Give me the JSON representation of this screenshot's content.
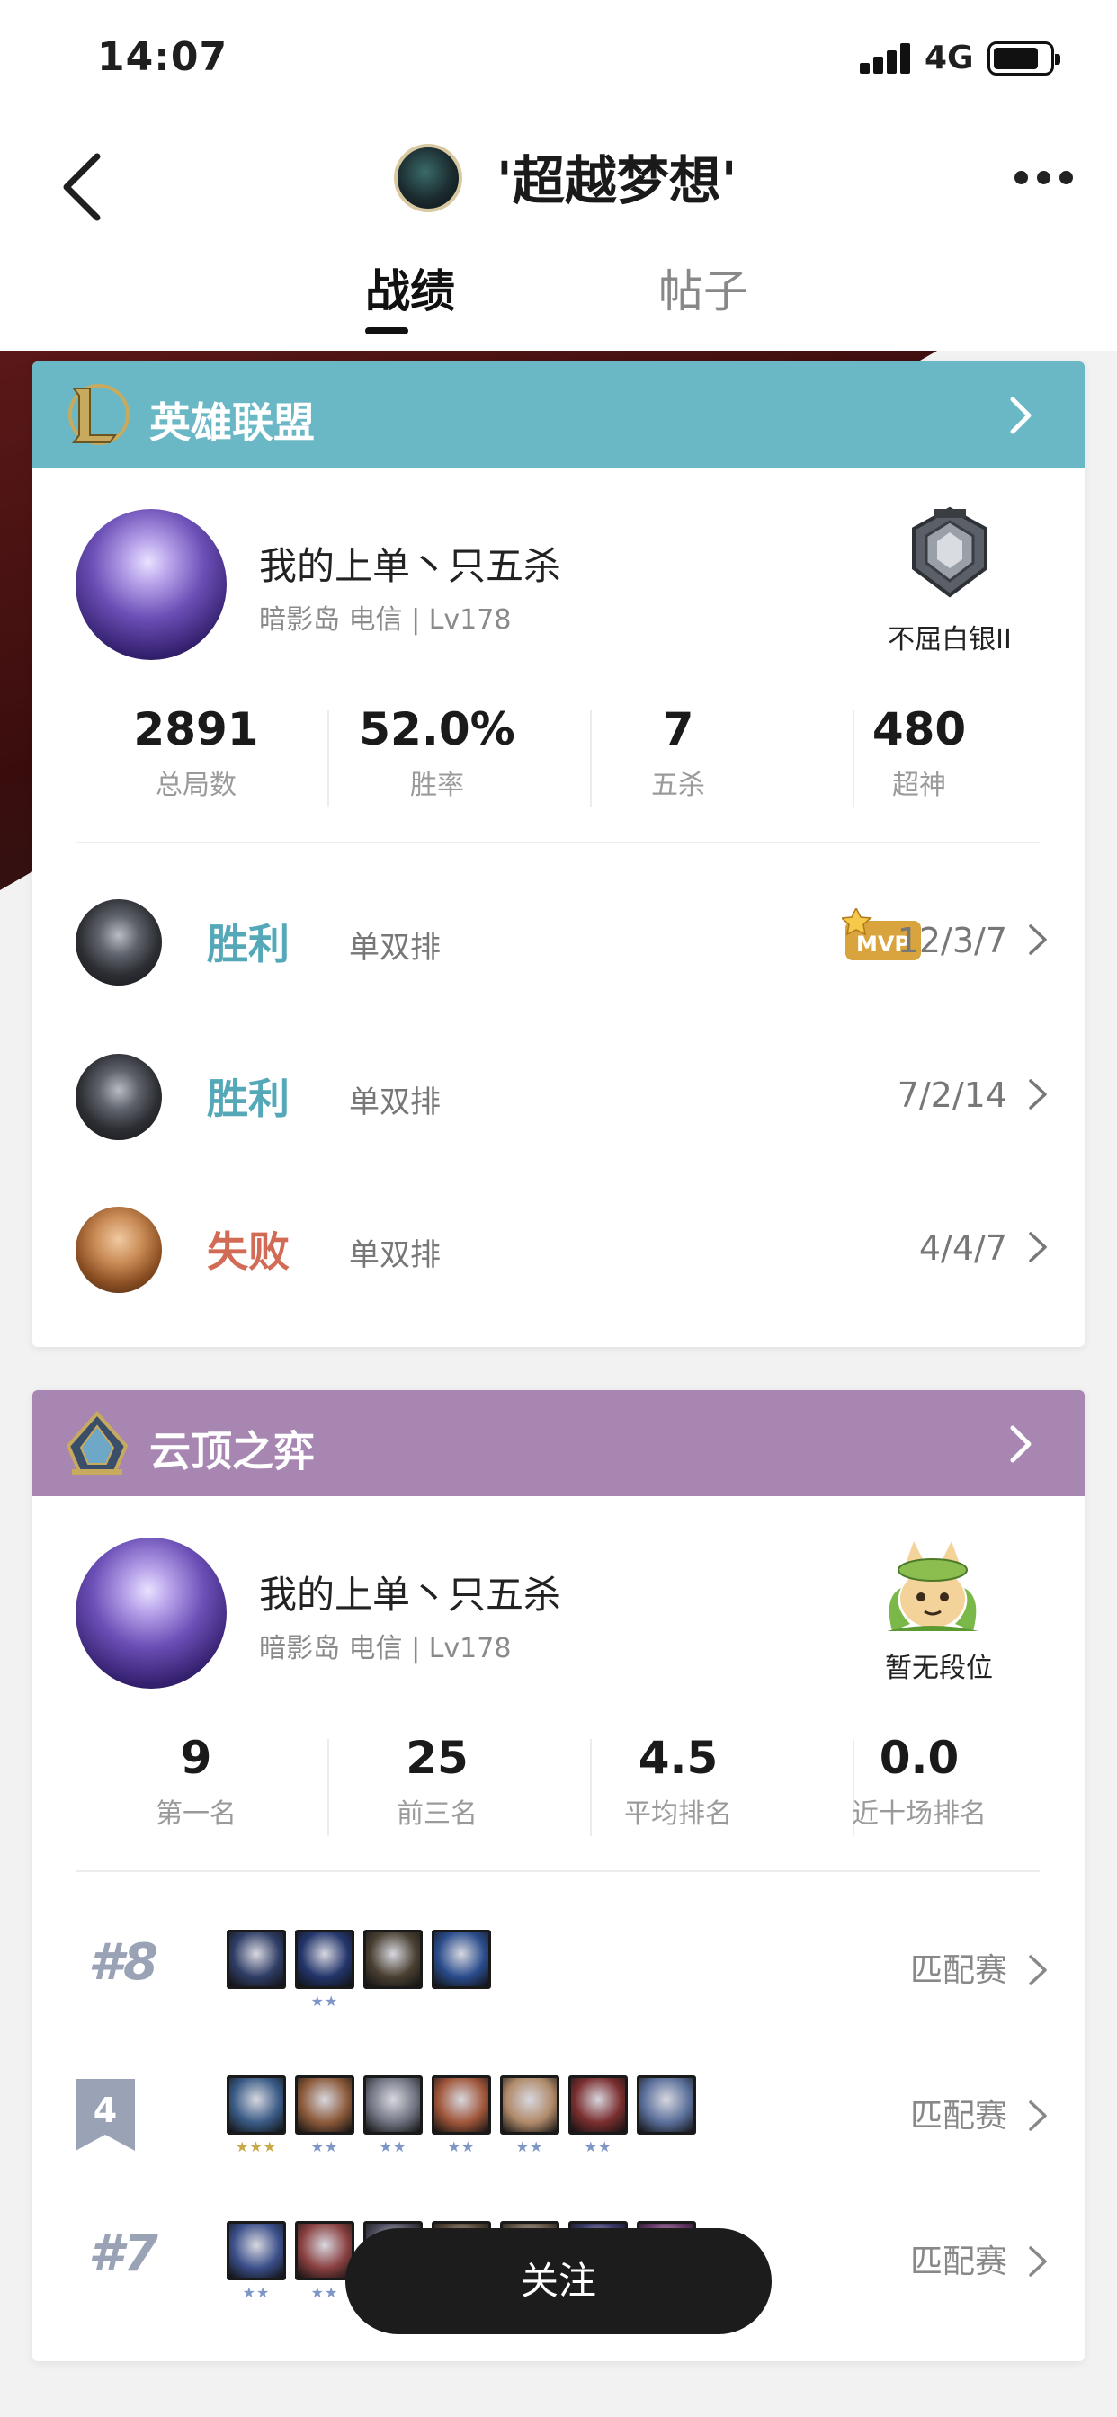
{
  "status_bar": {
    "time": "14:07",
    "network": "4G"
  },
  "header": {
    "username": "'超越梦想'",
    "tabs": [
      {
        "label": "战绩",
        "active": true
      },
      {
        "label": "帖子",
        "active": false
      }
    ]
  },
  "lol": {
    "title": "英雄联盟",
    "summoner_name": "我的上单丶只五杀",
    "server_info": "暗影岛 电信 | Lv178",
    "rank": "不屈白银II",
    "stats": [
      {
        "value": "2891",
        "label": "总局数"
      },
      {
        "value": "52.0%",
        "label": "胜率"
      },
      {
        "value": "7",
        "label": "五杀"
      },
      {
        "value": "480",
        "label": "超神"
      }
    ],
    "matches": [
      {
        "result": "胜利",
        "outcome": "win",
        "mode": "单双排",
        "mvp": true,
        "mvp_label": "MVP",
        "kda": "12/3/7"
      },
      {
        "result": "胜利",
        "outcome": "win",
        "mode": "单双排",
        "mvp": false,
        "kda": "7/2/14"
      },
      {
        "result": "失败",
        "outcome": "lose",
        "mode": "单双排",
        "mvp": false,
        "kda": "4/4/7"
      }
    ]
  },
  "tft": {
    "title": "云顶之弈",
    "summoner_name": "我的上单丶只五杀",
    "server_info": "暗影岛 电信 | Lv178",
    "rank": "暂无段位",
    "stats": [
      {
        "value": "9",
        "label": "第一名"
      },
      {
        "value": "25",
        "label": "前三名"
      },
      {
        "value": "4.5",
        "label": "平均排名"
      },
      {
        "value": "0.0",
        "label": "近十场排名"
      }
    ],
    "matches": [
      {
        "placement": "#8",
        "mode": "匹配赛",
        "units": [
          {
            "stars": 1,
            "color": "#2f3d66"
          },
          {
            "stars": 2,
            "color": "#23356b"
          },
          {
            "stars": 1,
            "color": "#4a4032"
          },
          {
            "stars": 1,
            "color": "#2a4c8c"
          }
        ]
      },
      {
        "placement": "4",
        "mode": "匹配赛",
        "units": [
          {
            "stars": 3,
            "color": "#3a5b86"
          },
          {
            "stars": 2,
            "color": "#8c5a3a"
          },
          {
            "stars": 2,
            "color": "#6f7380"
          },
          {
            "stars": 2,
            "color": "#a0563a"
          },
          {
            "stars": 2,
            "color": "#b08a6a"
          },
          {
            "stars": 2,
            "color": "#7a2e2e"
          },
          {
            "stars": 1,
            "color": "#5a6f9a"
          }
        ]
      },
      {
        "placement": "#7",
        "mode": "匹配赛",
        "units": [
          {
            "stars": 2,
            "color": "#3b4f8a"
          },
          {
            "stars": 2,
            "color": "#8a4040"
          },
          {
            "stars": 1,
            "color": "#4a4a5a"
          },
          {
            "stars": 1,
            "color": "#5a4a3a"
          },
          {
            "stars": 1,
            "color": "#6a5a4a"
          },
          {
            "stars": 1,
            "color": "#3a3a6a"
          },
          {
            "stars": 1,
            "color": "#6a3a6a"
          }
        ]
      }
    ]
  },
  "follow_label": "关注",
  "colors": {
    "lol_header": "#6ab8c5",
    "tft_header": "#a886b2",
    "win": "#54a8b7",
    "lose": "#d26b55",
    "star_gold": "#c8a94a",
    "star_blue": "#7d96c6"
  }
}
